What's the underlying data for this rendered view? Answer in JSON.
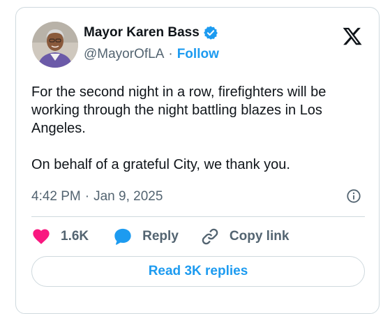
{
  "author": {
    "name": "Mayor Karen Bass",
    "handle": "@MayorOfLA",
    "separator": "·",
    "follow_label": "Follow",
    "verified_color": "#1d9bf0"
  },
  "tweet": {
    "paragraphs": [
      "For the second night in a row, firefighters will be working through the night battling blazes in Los Angeles.",
      "On behalf of a grateful City, we thank you."
    ],
    "time": "4:42 PM",
    "separator": "·",
    "date": "Jan 9, 2025"
  },
  "actions": {
    "like_count": "1.6K",
    "reply_label": "Reply",
    "copy_link_label": "Copy link"
  },
  "footer": {
    "read_replies_label": "Read 3K replies"
  },
  "icons": {
    "platform": "x-logo-icon",
    "info": "info-icon",
    "like": "heart-icon",
    "reply": "speech-bubble-icon",
    "copy": "link-icon"
  },
  "colors": {
    "accent": "#1d9bf0",
    "like": "#f91880",
    "text": "#0f1419",
    "secondary": "#536471"
  }
}
